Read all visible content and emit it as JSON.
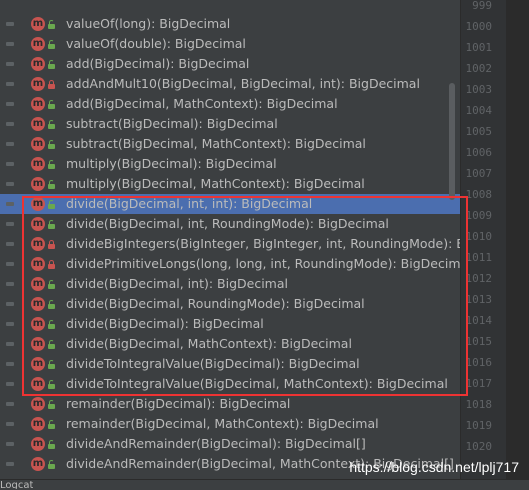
{
  "members": [
    {
      "signature": "valueOf(long): BigDecimal",
      "visibility": "public",
      "icon": "method-icon"
    },
    {
      "signature": "valueOf(double): BigDecimal",
      "visibility": "public",
      "icon": "method-icon"
    },
    {
      "signature": "add(BigDecimal): BigDecimal",
      "visibility": "public",
      "icon": "method-icon"
    },
    {
      "signature": "addAndMult10(BigDecimal, BigDecimal, int): BigDecimal",
      "visibility": "private",
      "icon": "method-icon"
    },
    {
      "signature": "add(BigDecimal, MathContext): BigDecimal",
      "visibility": "public",
      "icon": "method-icon"
    },
    {
      "signature": "subtract(BigDecimal): BigDecimal",
      "visibility": "public",
      "icon": "method-icon"
    },
    {
      "signature": "subtract(BigDecimal, MathContext): BigDecimal",
      "visibility": "public",
      "icon": "method-icon"
    },
    {
      "signature": "multiply(BigDecimal): BigDecimal",
      "visibility": "public",
      "icon": "method-icon"
    },
    {
      "signature": "multiply(BigDecimal, MathContext): BigDecimal",
      "visibility": "public",
      "icon": "method-icon"
    },
    {
      "signature": "divide(BigDecimal, int, int): BigDecimal",
      "visibility": "public",
      "icon": "method-icon",
      "selected": true
    },
    {
      "signature": "divide(BigDecimal, int, RoundingMode): BigDecimal",
      "visibility": "public",
      "icon": "method-icon"
    },
    {
      "signature": "divideBigIntegers(BigInteger, BigInteger, int, RoundingMode): BigD",
      "visibility": "private",
      "icon": "method-icon"
    },
    {
      "signature": "dividePrimitiveLongs(long, long, int, RoundingMode): BigDecimal",
      "visibility": "private",
      "icon": "method-icon"
    },
    {
      "signature": "divide(BigDecimal, int): BigDecimal",
      "visibility": "public",
      "icon": "method-icon"
    },
    {
      "signature": "divide(BigDecimal, RoundingMode): BigDecimal",
      "visibility": "public",
      "icon": "method-icon"
    },
    {
      "signature": "divide(BigDecimal): BigDecimal",
      "visibility": "public",
      "icon": "method-icon"
    },
    {
      "signature": "divide(BigDecimal, MathContext): BigDecimal",
      "visibility": "public",
      "icon": "method-icon"
    },
    {
      "signature": "divideToIntegralValue(BigDecimal): BigDecimal",
      "visibility": "public",
      "icon": "method-icon"
    },
    {
      "signature": "divideToIntegralValue(BigDecimal, MathContext): BigDecimal",
      "visibility": "public",
      "icon": "method-icon"
    },
    {
      "signature": "remainder(BigDecimal): BigDecimal",
      "visibility": "public",
      "icon": "method-icon"
    },
    {
      "signature": "remainder(BigDecimal, MathContext): BigDecimal",
      "visibility": "public",
      "icon": "method-icon"
    },
    {
      "signature": "divideAndRemainder(BigDecimal): BigDecimal[]",
      "visibility": "public",
      "icon": "method-icon"
    },
    {
      "signature": "divideAndRemainder(BigDecimal, MathContext): BigDecimal[]",
      "visibility": "public",
      "icon": "method-icon"
    }
  ],
  "line_numbers": [
    "999",
    "1000",
    "1001",
    "1002",
    "1003",
    "1004",
    "1005",
    "1006",
    "1007",
    "1008",
    "1009",
    "1010",
    "1011",
    "1012",
    "1013",
    "1014",
    "1015",
    "1016",
    "1017",
    "1018",
    "1019",
    "1020"
  ],
  "method_icon_letter": "m",
  "bottom_panel_label": "Logcat",
  "watermark": "https://blog.csdn.net/lplj717",
  "colors": {
    "selection": "#4b6eaf",
    "highlight_box": "#ee3333",
    "public": "#6aa84f",
    "private": "#c75450"
  }
}
